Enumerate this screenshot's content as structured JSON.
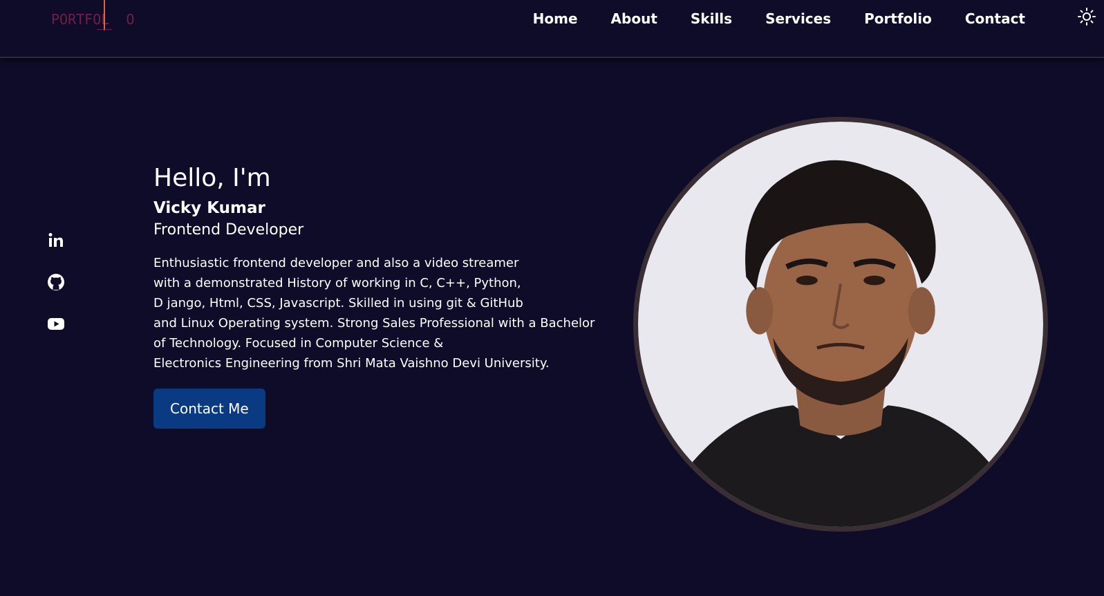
{
  "header": {
    "logo_text": "PORTFOL  O",
    "nav": [
      {
        "label": "Home"
      },
      {
        "label": "About"
      },
      {
        "label": "Skills"
      },
      {
        "label": "Services"
      },
      {
        "label": "Portfolio"
      },
      {
        "label": "Contact"
      }
    ],
    "theme_icon": "sun-icon"
  },
  "social": {
    "icons": [
      "linkedin-icon",
      "github-icon",
      "youtube-icon"
    ]
  },
  "hero": {
    "greeting": "Hello, I'm",
    "name": "Vicky Kumar",
    "role": "Frontend Developer",
    "bio_lines": [
      "Enthusiastic frontend developer and also a video streamer",
      "with a demonstrated History of working in C, C++, Python,",
      "D jango, Html, CSS, Javascript. Skilled in using git & GitHub",
      "and Linux Operating system. Strong Sales Professional with a Bachelor",
      "of Technology. Focused in Computer Science &",
      "Electronics Engineering from Shri Mata Vaishno Devi University."
    ],
    "cta_label": "Contact Me"
  },
  "colors": {
    "background": "#0e0c28",
    "button": "#0a3a82",
    "logo": "#6e1f4b",
    "photo_border": "#3a2e35"
  }
}
